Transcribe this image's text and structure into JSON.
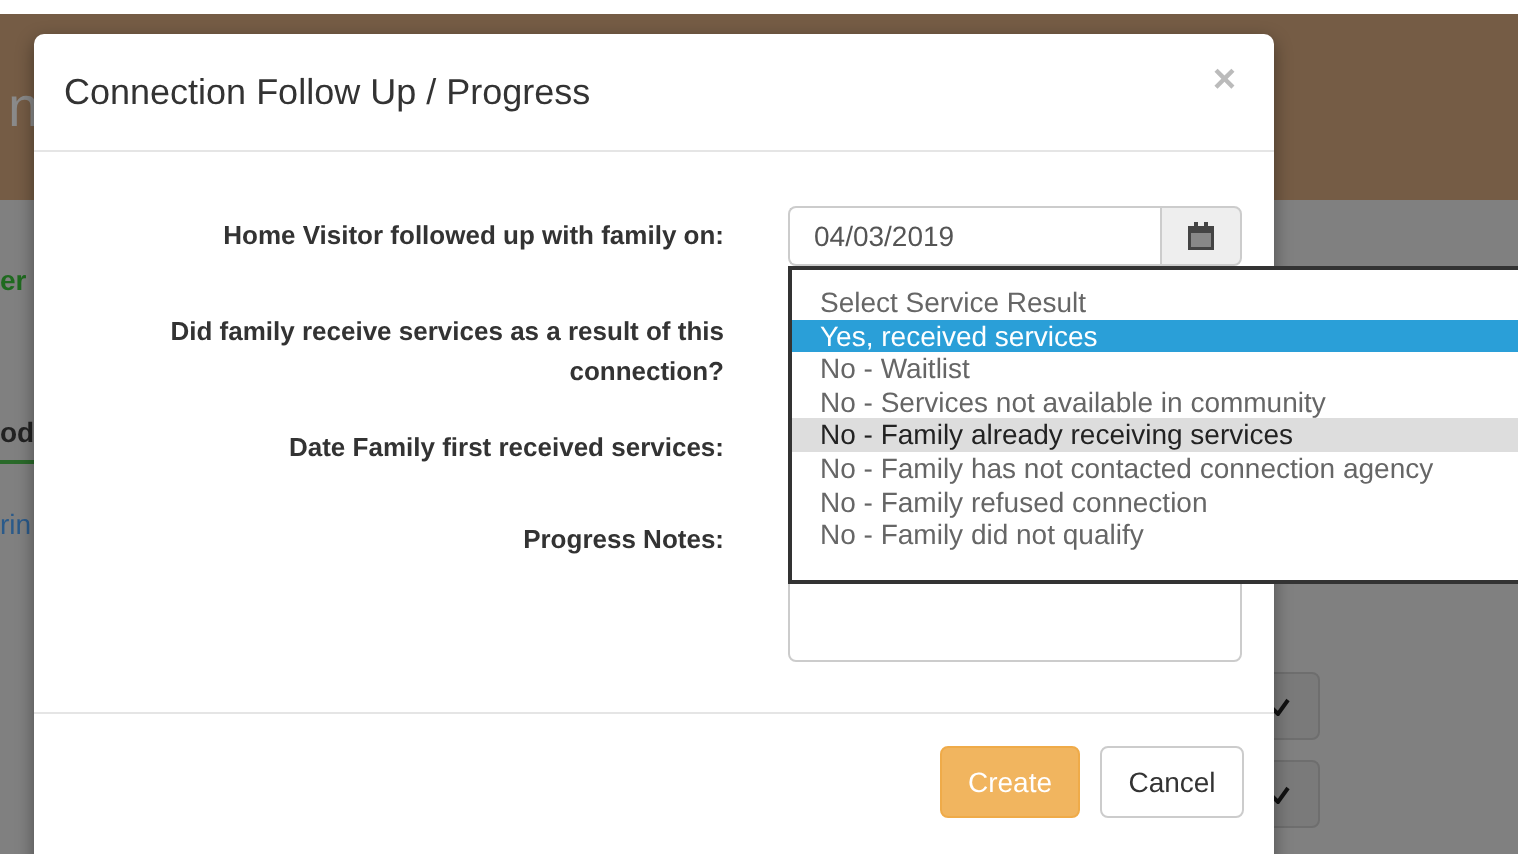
{
  "background_page": {
    "header_fragment": "n",
    "fragments": [
      {
        "kind": "heading",
        "text": "er"
      },
      {
        "kind": "tab",
        "text": "od"
      },
      {
        "kind": "link",
        "text": "rin"
      }
    ],
    "check_buttons": [
      {
        "kind": "check"
      },
      {
        "kind": "check"
      }
    ]
  },
  "modal": {
    "title": "Connection Follow Up / Progress",
    "close": "×",
    "fields": [
      {
        "kind": "date",
        "label": "Home Visitor followed up with family on:",
        "value": "04/03/2019"
      },
      {
        "kind": "select",
        "label": "Did family receive services as a result of this connection?"
      },
      {
        "kind": "date_hidden",
        "label": "Date Family first received services:"
      },
      {
        "kind": "textarea",
        "label": "Progress Notes:"
      }
    ],
    "dropdown": [
      {
        "label": "Select Service Result",
        "selected": false,
        "hovered": false
      },
      {
        "label": "Yes, received services",
        "selected": true,
        "hovered": false
      },
      {
        "label": "No - Waitlist",
        "selected": false,
        "hovered": false
      },
      {
        "label": "No - Services not available in community",
        "selected": false,
        "hovered": false
      },
      {
        "label": "No - Family already receiving services",
        "selected": false,
        "hovered": true
      },
      {
        "label": "No - Family has not contacted connection agency",
        "selected": false,
        "hovered": false
      },
      {
        "label": "No - Family refused connection",
        "selected": false,
        "hovered": false
      },
      {
        "label": "No - Family did not qualify",
        "selected": false,
        "hovered": false
      }
    ],
    "buttons": [
      {
        "kind": "primary",
        "label": "Create"
      },
      {
        "kind": "default",
        "label": "Cancel"
      }
    ]
  }
}
